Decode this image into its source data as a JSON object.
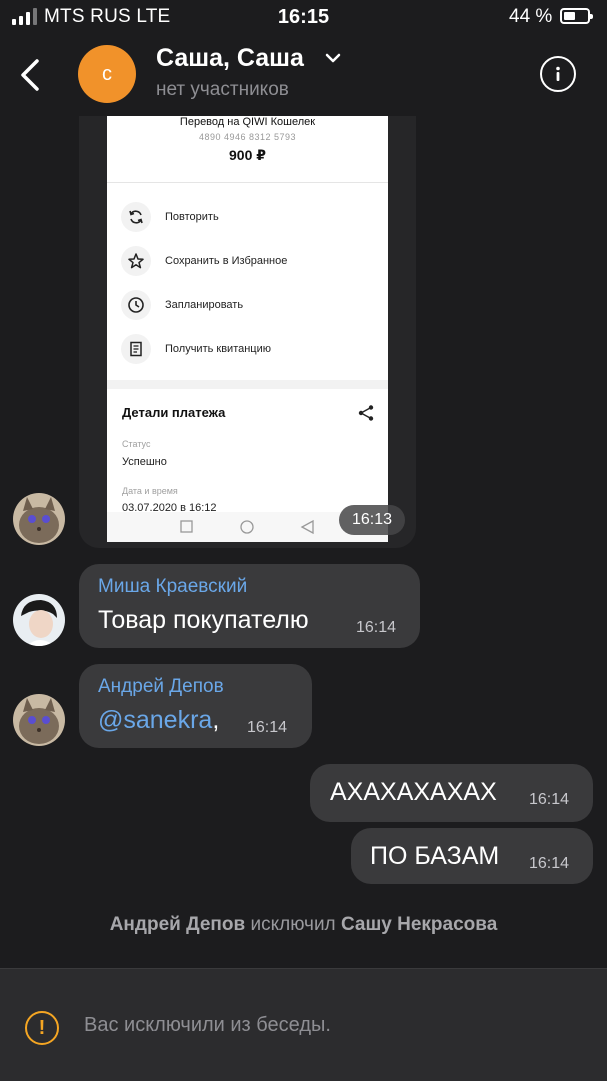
{
  "status_bar": {
    "carrier": "MTS RUS  LTE",
    "time": "16:15",
    "battery": "44 %"
  },
  "header": {
    "avatar_letter": "с",
    "title": "Саша, Саша",
    "subtitle": "нет участников"
  },
  "screenshot": {
    "title": "Перевод на QIWI Кошелек",
    "card": "4890 4946 8312 5793",
    "amount": "900 ₽",
    "actions": [
      "Повторить",
      "Сохранить в Избранное",
      "Запланировать",
      "Получить квитанцию"
    ],
    "details_title": "Детали платежа",
    "status_label": "Статус",
    "status_value": "Успешно",
    "date_label": "Дата и время",
    "date_value": "03.07.2020 в 16:12",
    "time": "16:13"
  },
  "messages": [
    {
      "sender": "Миша Краевский",
      "text": "Товар покупателю",
      "time": "16:14"
    },
    {
      "sender": "Андрей Депов",
      "mention": "@sanekra",
      "text_suffix": ",",
      "time": "16:14"
    },
    {
      "text": "АХАХАХАХАХ",
      "time": "16:14"
    },
    {
      "text": "ПО БАЗАМ",
      "time": "16:14"
    }
  ],
  "system_message": {
    "actor": "Андрей Депов",
    "action": "исключил",
    "target": "Сашу Некрасова"
  },
  "footer": {
    "text": "Вас исключили из беседы."
  },
  "colors": {
    "background": "#1c1c1e",
    "bubble": "#3a3a3c",
    "accent": "#6aa7e8",
    "avatar": "#f1922a",
    "warning": "#f5a623"
  },
  "icons": [
    "back-chevron-icon",
    "dropdown-chevron-icon",
    "info-icon",
    "repeat-icon",
    "star-icon",
    "clock-icon",
    "receipt-icon",
    "share-icon",
    "warning-icon"
  ]
}
